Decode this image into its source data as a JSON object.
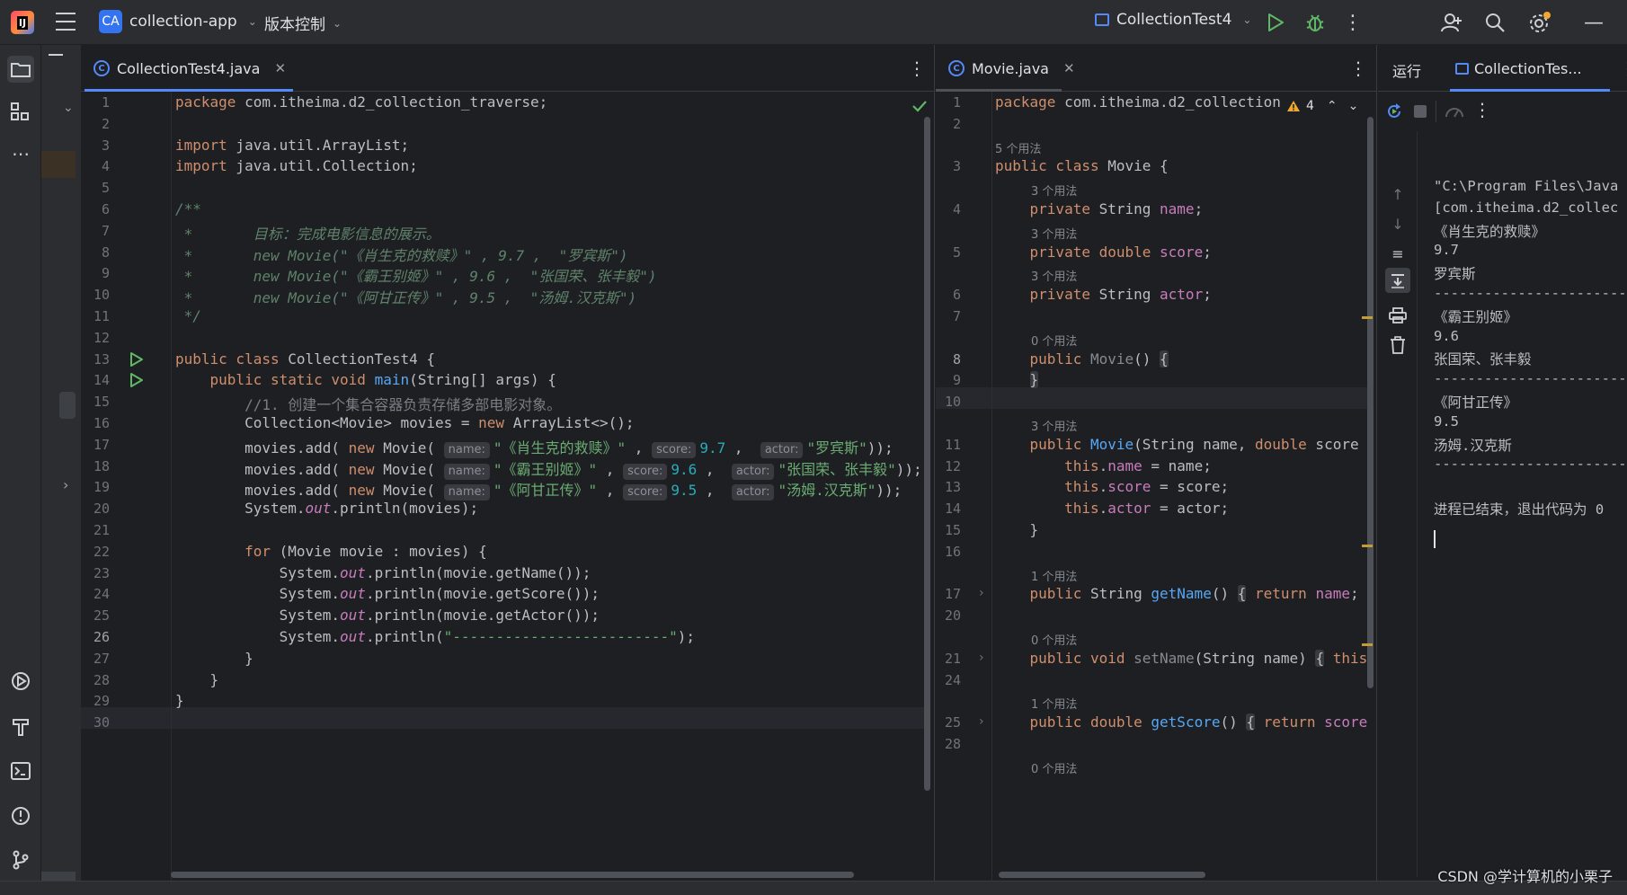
{
  "titlebar": {
    "project_badge": "CA",
    "project_name": "collection-app",
    "vcs_label": "版本控制",
    "run_config": "CollectionTest4"
  },
  "editor_left": {
    "tab_title": "CollectionTest4.java",
    "lines": [
      {
        "n": "1",
        "html": "<span class='kw'>package</span> com.itheima.d2_collection_traverse;"
      },
      {
        "n": "2",
        "html": ""
      },
      {
        "n": "3",
        "html": "<span class='kw'>import</span> java.util.ArrayList;"
      },
      {
        "n": "4",
        "html": "<span class='kw'>import</span> java.util.Collection;"
      },
      {
        "n": "5",
        "html": ""
      },
      {
        "n": "6",
        "html": "<span class='dc'>/**</span>"
      },
      {
        "n": "7",
        "html": "<span class='dc'> *       目标：完成电影信息的展示。</span>"
      },
      {
        "n": "8",
        "html": "<span class='dc'> *       new Movie(\"《肖生克的救赎》\" , 9.7 ,  \"罗宾斯\")</span>"
      },
      {
        "n": "9",
        "html": "<span class='dc'> *       new Movie(\"《霸王别姬》\" , 9.6 ,  \"张国荣、张丰毅\")</span>"
      },
      {
        "n": "10",
        "html": "<span class='dc'> *       new Movie(\"《阿甘正传》\" , 9.5 ,  \"汤姆.汉克斯\")</span>"
      },
      {
        "n": "11",
        "html": "<span class='dc'> */</span>"
      },
      {
        "n": "12",
        "html": ""
      },
      {
        "n": "13",
        "html": "<span class='kw'>public class</span> CollectionTest4 {"
      },
      {
        "n": "14",
        "html": "    <span class='kw'>public static void</span> <span class='fn'>main</span>(String[] args) {"
      },
      {
        "n": "15",
        "html": "        <span class='cm'>//1. 创建一个集合容器负责存储多部电影对象。</span>"
      },
      {
        "n": "16",
        "html": "        Collection&lt;Movie&gt; movies = <span class='kw'>new</span> ArrayList&lt;&gt;();"
      },
      {
        "n": "17",
        "html": "        movies.add( <span class='kw'>new</span> Movie( <span class='hint'>name:</span><span class='str'>\"《肖生克的救赎》\"</span> , <span class='hint'>score:</span><span class='num'>9.7</span> ,  <span class='hint'>actor:</span><span class='str'>\"罗宾斯\"</span>));"
      },
      {
        "n": "18",
        "html": "        movies.add( <span class='kw'>new</span> Movie( <span class='hint'>name:</span><span class='str'>\"《霸王别姬》\"</span> , <span class='hint'>score:</span><span class='num'>9.6</span> ,  <span class='hint'>actor:</span><span class='str'>\"张国荣、张丰毅\"</span>));"
      },
      {
        "n": "19",
        "html": "        movies.add( <span class='kw'>new</span> Movie( <span class='hint'>name:</span><span class='str'>\"《阿甘正传》\"</span> , <span class='hint'>score:</span><span class='num'>9.5</span> ,  <span class='hint'>actor:</span><span class='str'>\"汤姆.汉克斯\"</span>));"
      },
      {
        "n": "20",
        "html": "        System.<span class='st'>out</span>.println(movies);"
      },
      {
        "n": "21",
        "html": ""
      },
      {
        "n": "22",
        "html": "        <span class='kw'>for</span> (Movie movie : movies) {"
      },
      {
        "n": "23",
        "html": "            System.<span class='st'>out</span>.println(movie.getName());"
      },
      {
        "n": "24",
        "html": "            System.<span class='st'>out</span>.println(movie.getScore());"
      },
      {
        "n": "25",
        "html": "            System.<span class='st'>out</span>.println(movie.getActor());"
      },
      {
        "n": "26",
        "html": "            System.<span class='st'>out</span>.println(<span class='str'>\"-------------------------\"</span>);"
      },
      {
        "n": "27",
        "html": "        }"
      },
      {
        "n": "28",
        "html": "    }"
      },
      {
        "n": "29",
        "html": "}"
      },
      {
        "n": "30",
        "html": ""
      }
    ]
  },
  "editor_right": {
    "tab_title": "Movie.java",
    "warning_count": "4",
    "lines": [
      {
        "n": "1",
        "html": "<span class='kw'>package</span> com.itheima.d2_collection"
      },
      {
        "n": "2",
        "html": ""
      },
      {
        "n": "",
        "usage": "5 个用法"
      },
      {
        "n": "3",
        "html": "<span class='kw'>public class</span> Movie {"
      },
      {
        "n": "",
        "usage": "3 个用法",
        "indent": 1
      },
      {
        "n": "4",
        "html": "    <span class='kw'>private</span> String <span class='fld'>name</span>;"
      },
      {
        "n": "",
        "usage": "3 个用法",
        "indent": 1
      },
      {
        "n": "5",
        "html": "    <span class='kw'>private double</span> <span class='fld'>score</span>;"
      },
      {
        "n": "",
        "usage": "3 个用法",
        "indent": 1
      },
      {
        "n": "6",
        "html": "    <span class='kw'>private</span> String <span class='fld'>actor</span>;"
      },
      {
        "n": "7",
        "html": ""
      },
      {
        "n": "",
        "usage": "0 个用法",
        "indent": 1
      },
      {
        "n": "8",
        "html": "    <span class='kw'>public</span> <span class='gray'>Movie</span>() <span class='foldbox'>{</span>"
      },
      {
        "n": "9",
        "html": "    <span class='foldbox'>}</span>"
      },
      {
        "n": "10",
        "html": ""
      },
      {
        "n": "",
        "usage": "3 个用法",
        "indent": 1
      },
      {
        "n": "11",
        "html": "    <span class='kw'>public</span> <span class='fn'>Movie</span>(String name, <span class='kw'>double</span> score"
      },
      {
        "n": "12",
        "html": "        <span class='kw'>this</span>.<span class='fld'>name</span> = name;"
      },
      {
        "n": "13",
        "html": "        <span class='kw'>this</span>.<span class='fld'>score</span> = score;"
      },
      {
        "n": "14",
        "html": "        <span class='kw'>this</span>.<span class='fld'>actor</span> = actor;"
      },
      {
        "n": "15",
        "html": "    }"
      },
      {
        "n": "16",
        "html": ""
      },
      {
        "n": "",
        "usage": "1 个用法",
        "indent": 1
      },
      {
        "n": "17",
        "html": "    <span class='kw'>public</span> String <span class='fn'>getName</span>() <span class='foldbox'>{</span> <span class='kw'>return</span> <span class='fld'>name</span>;"
      },
      {
        "n": "20",
        "html": ""
      },
      {
        "n": "",
        "usage": "0 个用法",
        "indent": 1
      },
      {
        "n": "21",
        "html": "    <span class='kw'>public void</span> <span class='gray'>setName</span>(String name) <span class='foldbox'>{</span> <span class='kw'>this</span>"
      },
      {
        "n": "24",
        "html": ""
      },
      {
        "n": "",
        "usage": "1 个用法",
        "indent": 1
      },
      {
        "n": "25",
        "html": "    <span class='kw'>public double</span> <span class='fn'>getScore</span>() <span class='foldbox'>{</span> <span class='kw'>return</span> <span class='fld'>score</span>"
      },
      {
        "n": "28",
        "html": ""
      },
      {
        "n": "",
        "usage": "0 个用法",
        "indent": 1
      }
    ]
  },
  "run_window": {
    "tab_run": "运行",
    "tab_config": "CollectionTes...",
    "console_lines": [
      "\"C:\\Program Files\\Java",
      "[com.itheima.d2_collec",
      "《肖生克的救赎》",
      "9.7",
      "罗宾斯",
      "-------------------------",
      "《霸王别姬》",
      "9.6",
      "张国荣、张丰毅",
      "-------------------------",
      "《阿甘正传》",
      "9.5",
      "汤姆.汉克斯",
      "-------------------------",
      "",
      "进程已结束，退出代码为 0"
    ]
  },
  "watermark": "CSDN @学计算机的小栗子",
  "colors": {
    "background": "#1e1f22",
    "panel": "#2b2d30",
    "accent": "#548af7",
    "keyword": "#cf8e6d",
    "string": "#6aab73",
    "number": "#2aacb8",
    "function": "#56a8f5",
    "field": "#c77dbb",
    "run_green": "#5fb865"
  }
}
